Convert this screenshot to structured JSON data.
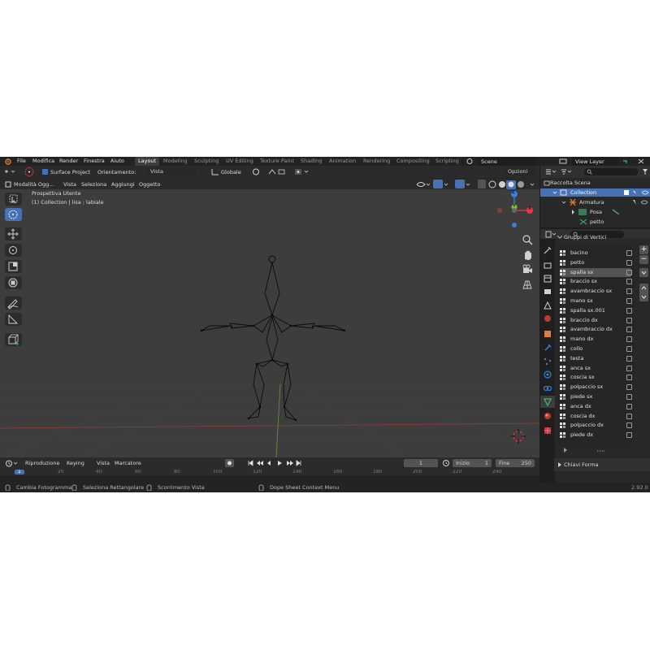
{
  "menu": {
    "items": [
      "File",
      "Modifica",
      "Render",
      "Finestra",
      "Aiuto"
    ],
    "workspaces": [
      "Layout",
      "Modeling",
      "Sculpting",
      "UV Editing",
      "Texture Paint",
      "Shading",
      "Animation",
      "Rendering",
      "Compositing",
      "Scripting"
    ],
    "active_workspace": "Layout",
    "scene": "Scene",
    "view_layer": "View Layer"
  },
  "toolbar": {
    "surface_project": "Surface Project",
    "orientation_label": "Orientamento:",
    "orientation_value": "Vista",
    "transform": "Globale",
    "options": "Opzioni"
  },
  "header": {
    "mode": "Modalità Ogg...",
    "menus": [
      "Vista",
      "Seleziona",
      "Aggiungi",
      "Oggetto"
    ]
  },
  "viewport": {
    "view_name": "Prospettiva Utente",
    "collection_info": "(1) Collection | lisa : labiale",
    "gizmo_axes": [
      "X",
      "Y",
      "Z"
    ]
  },
  "outliner": {
    "title": "Raccolta Scena",
    "rows": [
      {
        "label": "Collection",
        "level": 1
      },
      {
        "label": "Armatura",
        "level": 2
      },
      {
        "label": "Posa",
        "level": 3
      },
      {
        "label": "petto",
        "level": 3
      }
    ]
  },
  "properties": {
    "panel_title": "Gruppi di Vertici",
    "vertex_groups": [
      "bacino",
      "petto",
      "spalla sx",
      "braccio sx",
      "avambraccio sx",
      "mano sx",
      "spalla sx.001",
      "braccio dx",
      "avambraccio dx",
      "mano dx",
      "collo",
      "testa",
      "anca sx",
      "coscia sx",
      "polpaccio sx",
      "piede sx",
      "anca dx",
      "coscia dx",
      "polpaccio dx",
      "piede dx"
    ],
    "selected_index": 2,
    "shape_keys_title": "Chiavi Forma"
  },
  "timeline": {
    "menus": [
      "Riproduzione",
      "Keying",
      "Vista",
      "Marcatore"
    ],
    "current_frame": "1",
    "start_label": "Inizio",
    "start_value": "1",
    "end_label": "Fine",
    "end_value": "250",
    "ticks": [
      "1",
      "20",
      "40",
      "60",
      "80",
      "100",
      "120",
      "140",
      "160",
      "180",
      "200",
      "220",
      "240"
    ]
  },
  "statusbar": {
    "items": [
      "Cambia Fotogramma",
      "Seleziona Rettangolare",
      "Scorrimento Vista",
      "Dope Sheet Context Menu"
    ],
    "version": "2.92.0"
  },
  "colors": {
    "accent_blue": "#4772b3",
    "axis_x": "#e8394b",
    "axis_y": "#88c62c",
    "axis_z": "#3b7fd8",
    "armature_icon": "#e0803a",
    "green_icon": "#47b86b"
  }
}
